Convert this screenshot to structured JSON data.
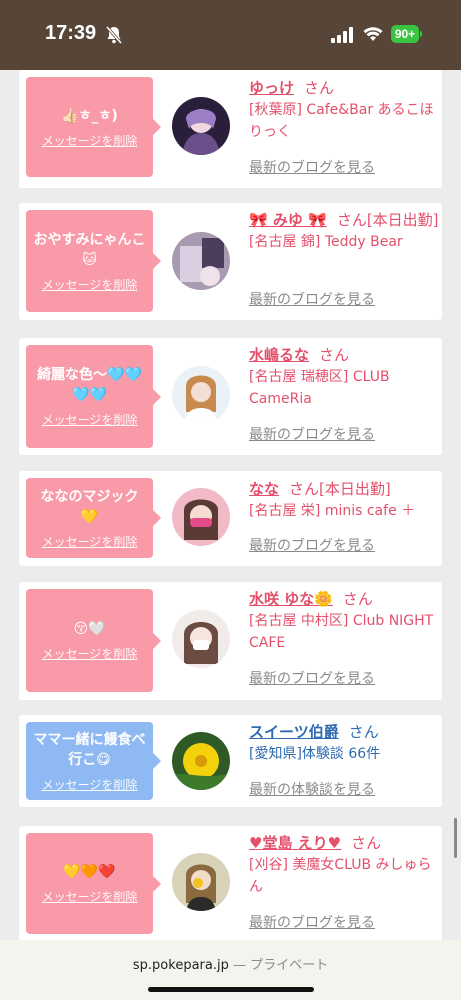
{
  "status": {
    "time": "17:39",
    "battery": "90+",
    "bell_icon": "bell-slash-icon",
    "signal_icon": "cellular-signal-icon",
    "wifi_icon": "wifi-icon"
  },
  "colors": {
    "header_bg": "#574637",
    "pink_bubble": "#f99aa8",
    "blue_bubble": "#8fb9f2",
    "name_pink": "#e4506b",
    "name_blue": "#2f6bb0",
    "battery_green": "#3ac441"
  },
  "cards": [
    {
      "message": "👍🏻ㅎ_ㅎ)",
      "delete_label": "メッセージを削除",
      "name": "ゆっけ",
      "san": "さん",
      "shop": "[秋葉原] Cafe&Bar あるこほりっく",
      "link": "最新のブログを見る"
    },
    {
      "message": "おやすみにゃんこ🐱",
      "delete_label": "メッセージを削除",
      "name": "🎀 みゆ 🎀",
      "san": "さん[本日出勤]",
      "shop": "[名古屋 錦] Teddy Bear",
      "link": "最新のブログを見る"
    },
    {
      "message": "綺麗な色〜🩵🩵🩵🩵",
      "delete_label": "メッセージを削除",
      "name": "水嶋るな",
      "san": "さん",
      "shop": "[名古屋 瑞穂区] CLUB CameRia",
      "link": "最新のブログを見る"
    },
    {
      "message": "ななのマジック💛",
      "delete_label": "メッセージを削除",
      "name": "なな",
      "san": "さん[本日出勤]",
      "shop": "[名古屋 栄] minis cafe ＋",
      "link": "最新のブログを見る"
    },
    {
      "message": "😚🤍",
      "delete_label": "メッセージを削除",
      "name": "水咲 ゆな🌼",
      "san": "さん",
      "shop": "[名古屋 中村区] Club NIGHT CAFE",
      "link": "最新のブログを見る"
    },
    {
      "message": "ママー緒に饅食べ行こ😋",
      "delete_label": "メッセージを削除",
      "name": "スイーツ伯爵",
      "san": "さん",
      "shop": "[愛知県]体験談 66件",
      "link": "最新の体験談を見る"
    },
    {
      "message": "💛🧡❤️",
      "delete_label": "メッセージを削除",
      "name": "♥堂島 えり♥",
      "san": "さん",
      "shop": "[刈谷] 美魔女CLUB みしゅらん",
      "link": "最新のブログを見る"
    }
  ],
  "browser": {
    "domain": "sp.pokepara.jp",
    "mode": " — プライベート"
  }
}
